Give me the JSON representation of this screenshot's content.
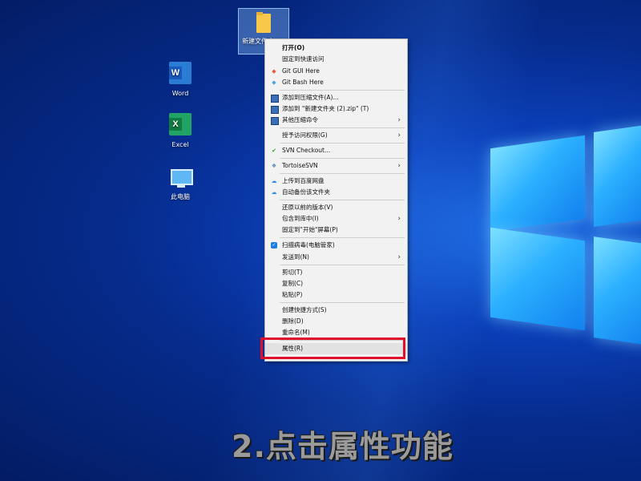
{
  "desktop": {
    "icons": [
      {
        "label": "新建文件夹 (2)"
      },
      {
        "label": "Word",
        "badge": "W"
      },
      {
        "label": "Excel",
        "badge": "X"
      },
      {
        "label": "此电脑"
      }
    ]
  },
  "context_menu": {
    "items": [
      {
        "label": "打开(O)",
        "icon": "none"
      },
      {
        "label": "固定到快速访问",
        "icon": "none"
      },
      {
        "label": "Git GUI Here",
        "icon": "git-gui-icon"
      },
      {
        "label": "Git Bash Here",
        "icon": "git-bash-icon"
      },
      {
        "label": "添加到压缩文件(A)...",
        "icon": "archive-icon"
      },
      {
        "label": "添加到 \"新建文件夹 (2).zip\" (T)",
        "icon": "archive-icon"
      },
      {
        "label": "其他压缩命令",
        "icon": "archive-icon"
      },
      {
        "label": "授予访问权限(G)",
        "icon": "none"
      },
      {
        "label": "SVN Checkout...",
        "icon": "svn-checkout-icon"
      },
      {
        "label": "TortoiseSVN",
        "icon": "tortoisesvn-icon"
      },
      {
        "label": "上传到百度网盘",
        "icon": "baidu-cloud-icon"
      },
      {
        "label": "自动备份该文件夹",
        "icon": "baidu-cloud-icon"
      },
      {
        "label": "还原以前的版本(V)",
        "icon": "none"
      },
      {
        "label": "包含到库中(I)",
        "icon": "none"
      },
      {
        "label": "固定到\"开始\"屏幕(P)",
        "icon": "none"
      },
      {
        "label": "扫描病毒(电脑管家)",
        "icon": "shield-icon"
      },
      {
        "label": "发送到(N)",
        "icon": "none"
      },
      {
        "label": "剪切(T)",
        "icon": "none"
      },
      {
        "label": "复制(C)",
        "icon": "none"
      },
      {
        "label": "粘贴(P)",
        "icon": "none"
      },
      {
        "label": "创建快捷方式(S)",
        "icon": "none"
      },
      {
        "label": "删除(D)",
        "icon": "none"
      },
      {
        "label": "重命名(M)",
        "icon": "none"
      },
      {
        "label": "属性(R)",
        "icon": "none"
      }
    ],
    "submenu_arrow": "›"
  },
  "caption": "2.点击属性功能",
  "colors": {
    "highlight": "#e0102a",
    "menu_bg": "#f2f2f2",
    "desktop": "#0b3fb8"
  }
}
